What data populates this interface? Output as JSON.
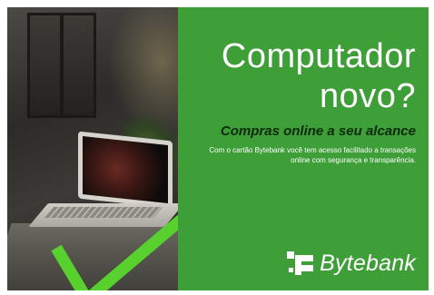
{
  "headline": {
    "line1": "Computador",
    "line2": "novo?"
  },
  "subtitle": "Compras online a seu alcance",
  "body_text": "Com o cartão Bytebank você tem acesso facilitado a transações online com segurança e transparência.",
  "logo": {
    "name": "Bytebank",
    "icon": "bytebank-logo-icon"
  },
  "colors": {
    "brand_green": "#3e9e37",
    "check_green": "#58d12f",
    "subtitle_dark": "#0e2a0c",
    "text_white": "#ffffff"
  }
}
